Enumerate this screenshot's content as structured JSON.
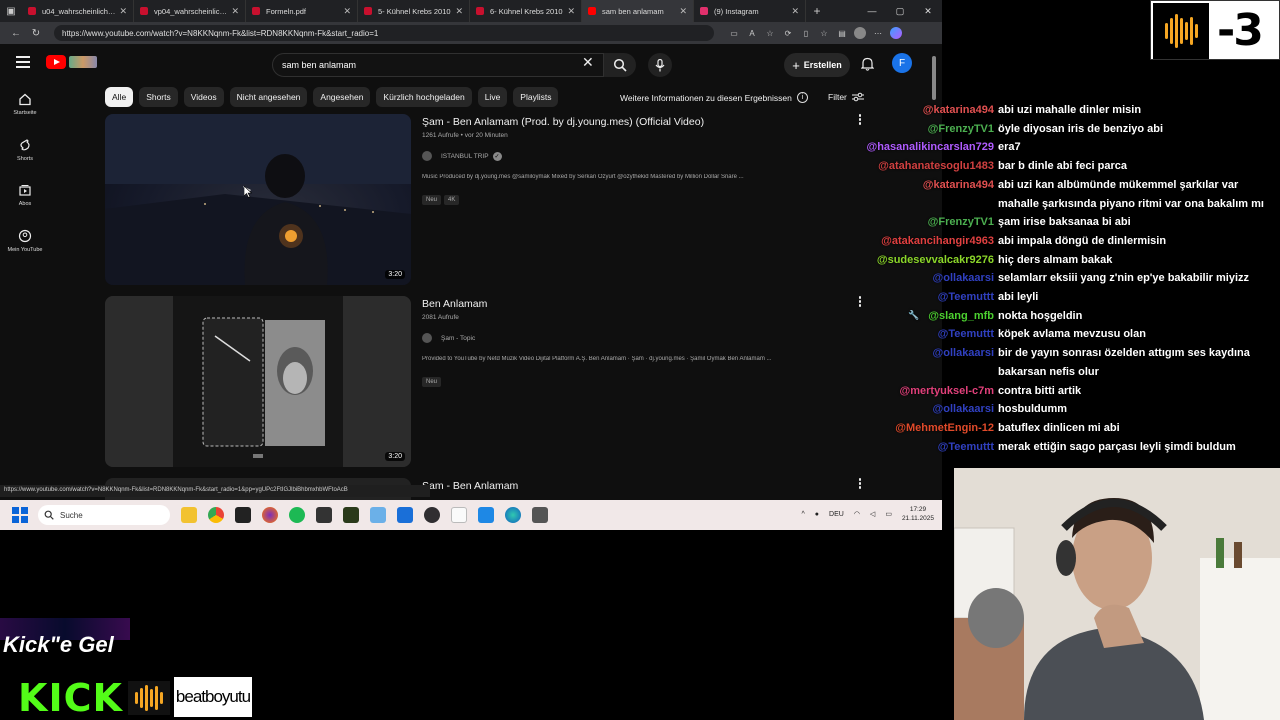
{
  "browser": {
    "tabs": [
      {
        "label": "u04_wahrscheinlichkei",
        "color": "#c8102e"
      },
      {
        "label": "vp04_wahrscheinlichke",
        "color": "#c8102e"
      },
      {
        "label": "Formeln.pdf",
        "color": "#c8102e"
      },
      {
        "label": "5- Kühnel Krebs 2010",
        "color": "#c8102e"
      },
      {
        "label": "6- Kühnel Krebs 2010",
        "color": "#c8102e"
      },
      {
        "label": "sam ben anlamam",
        "color": "#ff0000"
      },
      {
        "label": "(9) Instagram",
        "color": "#e1306c"
      }
    ],
    "url": "https://www.youtube.com/watch?v=N8KKNqnm-Fk&list=RDN8KKNqnm-Fk&start_radio=1",
    "status_url": "https://www.youtube.com/watch?v=N8KKNqnm-Fk&list=RDN8KKNqnm-Fk&start_radio=1&pp=ygUPc2FtIGJlbiBhbmxhbWFtoAcB"
  },
  "youtube": {
    "search_value": "sam ben anlamam",
    "create_label": "Erstellen",
    "avatar_letter": "F",
    "nav": [
      {
        "label": "Startseite",
        "icon": "home-icon"
      },
      {
        "label": "Shorts",
        "icon": "shorts-icon"
      },
      {
        "label": "Abos",
        "icon": "subscriptions-icon"
      },
      {
        "label": "Mein YouTube",
        "icon": "my-youtube-icon"
      }
    ],
    "chips": [
      "Alle",
      "Shorts",
      "Videos",
      "Nicht angesehen",
      "Angesehen",
      "Kürzlich hochgeladen",
      "Live",
      "Playlists"
    ],
    "more_info": "Weitere Informationen zu diesen Ergebnissen",
    "filter_label": "Filter",
    "results": [
      {
        "title": "Şam - Ben Anlamam (Prod. by dj.young.mes) (Official Video)",
        "meta": "1261 Aufrufe • vor 20 Minuten",
        "channel": "ISTANBUL TRIP",
        "desc": "Music Produced by dj.young.mes @samiloymak Mixed by Serkan Özyurt @ozythekid Mastered by Million Dollar Snare ...",
        "badges": [
          "Neu",
          "4K"
        ],
        "duration": "3:20"
      },
      {
        "title": "Ben Anlamam",
        "meta": "2081 Aufrufe",
        "channel": "Şam - Topic",
        "desc": "Provided to YouTube by Netd Müzik Video Dijital Platform A.Ş. Ben Anlamam · Şam · dj.young.mes · Şamil Oymak Ben Anlamam ...",
        "badges": [
          "Neu"
        ],
        "duration": "3:20"
      },
      {
        "title": "Şam - Ben Anlamam"
      }
    ]
  },
  "taskbar": {
    "search_placeholder": "Suche",
    "lang": "DEU",
    "time": "17:29",
    "date": "21.11.2025"
  },
  "chat": [
    {
      "user": "@katarina494",
      "color": "#e05050",
      "text": "abi uzi mahalle dinler misin"
    },
    {
      "user": "@FrenzyTV1",
      "color": "#4caf50",
      "text": "öyle diyosan iris de benziyo abi"
    },
    {
      "user": "@hasanalikincarslan729",
      "color": "#b05cff",
      "text": "era7"
    },
    {
      "user": "@atahanatesoglu1483",
      "color": "#d04040",
      "text": "bar b dinle abi feci parca"
    },
    {
      "user": "@katarina494",
      "color": "#e05050",
      "text": "abi uzi kan albümünde mükemmel şarkılar var"
    },
    {
      "user": "",
      "color": "#ffffff",
      "text": "mahalle şarkısında piyano ritmi var ona bakalım mı"
    },
    {
      "user": "@FrenzyTV1",
      "color": "#4caf50",
      "text": "şam irise baksanaa bi abi"
    },
    {
      "user": "@atakancihangir4963",
      "color": "#e04040",
      "text": "abi impala döngü de dinlermisin"
    },
    {
      "user": "@sudesevvalcakr9276",
      "color": "#8bd62a",
      "text": "hiç ders almam bakak"
    },
    {
      "user": "@ollakaarsi",
      "color": "#3040c0",
      "text": "selamlarr eksiii yang z'nin ep'ye bakabilir miyizz"
    },
    {
      "user": "@Teemuttt",
      "color": "#3040c0",
      "text": "abi leyli"
    },
    {
      "user": "@slang_mfb",
      "color": "#4cd030",
      "text": "nokta hoşgeldin"
    },
    {
      "user": "@Teemuttt",
      "color": "#3040c0",
      "text": "köpek avlama mevzusu olan"
    },
    {
      "user": "@ollakaarsi",
      "color": "#3040c0",
      "text": "bir de yayın sonrası özelden attıgım ses kaydına"
    },
    {
      "user": "",
      "color": "#ffffff",
      "text": "bakarsan nefis olur"
    },
    {
      "user": "@mertyuksel-c7m",
      "color": "#e0407a",
      "text": "contra bitti artik"
    },
    {
      "user": "@ollakaarsi",
      "color": "#3040c0",
      "text": "hosbuldumm"
    },
    {
      "user": "@MehmetEngin-12",
      "color": "#e04a2a",
      "text": "batuflex dinlicen mi abi"
    },
    {
      "user": "@Teemuttt",
      "color": "#3040c0",
      "text": "merak ettiğin sago parçası leyli şimdi buldum"
    }
  ],
  "overlay": {
    "counter": "-3",
    "promo_text": "Kick\"e Gel",
    "kick_text": "KICK",
    "beat_name": "beatboyutu"
  }
}
